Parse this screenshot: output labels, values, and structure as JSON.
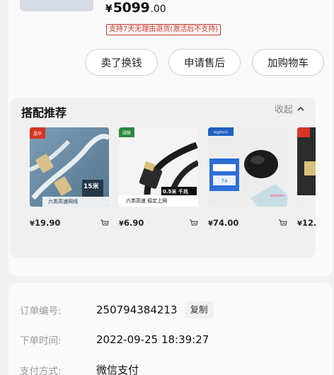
{
  "order": {
    "price_symbol": "¥",
    "price_main": "5099",
    "price_decimal": ".00",
    "return_policy": "支持7天无理由退货(激活后不支持)"
  },
  "actions": {
    "sell": "卖了换钱",
    "service": "申请售后",
    "cart": "加购物车"
  },
  "recommendations": {
    "title": "搭配推荐",
    "collapse_label": "收起",
    "items": [
      {
        "price": "19.90",
        "badge": "15米",
        "caption": "六类高速网线",
        "brand": "绿联"
      },
      {
        "price": "6.90",
        "badge": "0.5米 千兆",
        "caption": "六类高速 稳定上网",
        "brand": "绿联"
      },
      {
        "price": "74.00",
        "brand": "logitech"
      },
      {
        "price": "12."
      }
    ],
    "currency": "¥"
  },
  "info": {
    "order_no_label": "订单编号:",
    "order_no": "250794384213",
    "copy_label": "复制",
    "order_time_label": "下单时间:",
    "order_time": "2022-09-25 18:39:27",
    "payment_label": "支付方式:",
    "payment": "微信支付"
  },
  "colors": {
    "accent_red": "#c73b2e",
    "background": "#f1f1f1",
    "card": "#fafafa"
  }
}
